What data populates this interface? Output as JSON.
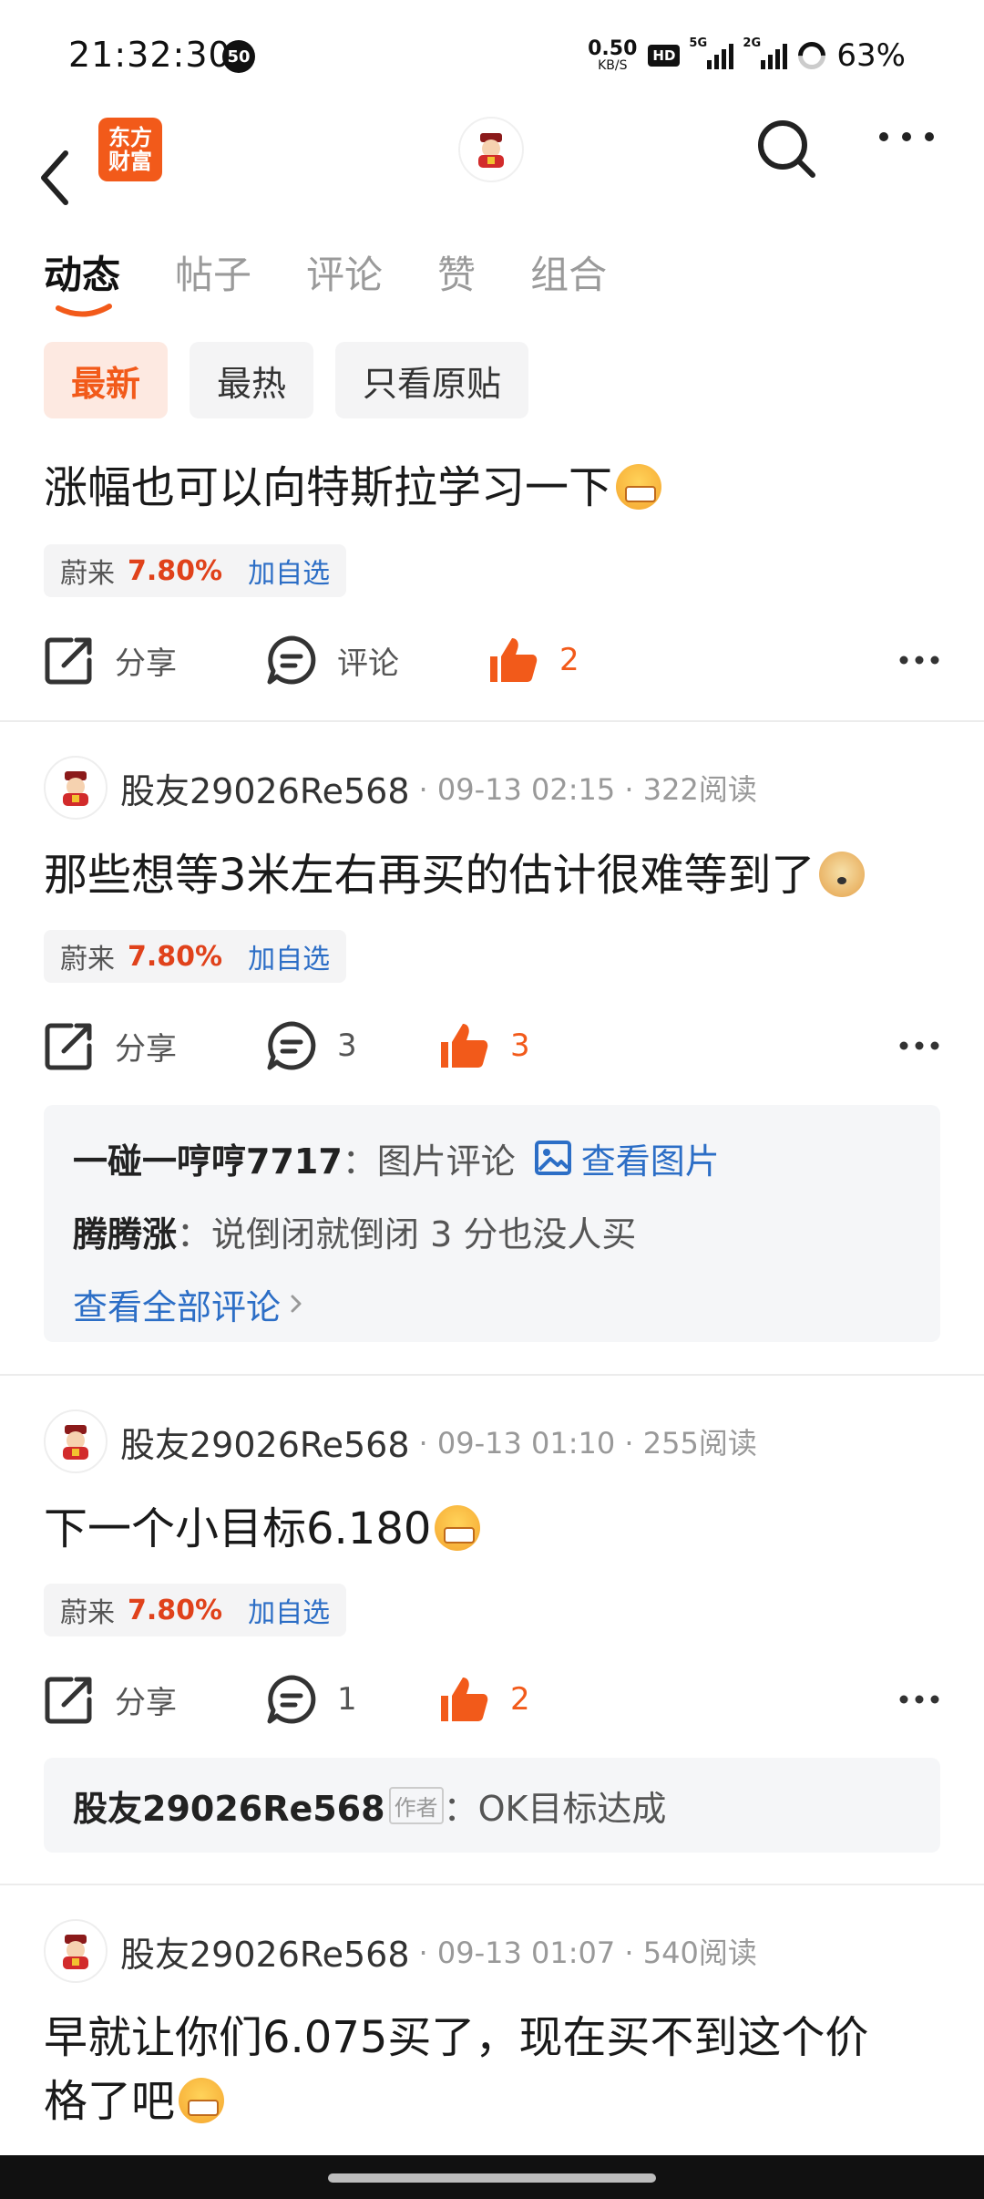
{
  "status_bar": {
    "time": "21:32:30",
    "notification_count": "50",
    "net_speed_value": "0.50",
    "net_speed_unit": "KB/S",
    "hd_label": "HD",
    "signal1_label": "5G",
    "signal2_label": "2G",
    "battery_percent": "63%"
  },
  "header": {
    "app_logo_line1": "东方",
    "app_logo_line2": "财富"
  },
  "tabs": [
    "动态",
    "帖子",
    "评论",
    "赞",
    "组合"
  ],
  "filters": [
    "最新",
    "最热",
    "只看原贴"
  ],
  "share_label": "分享",
  "comment_label": "评论",
  "posts": [
    {
      "text": "涨幅也可以向特斯拉学习一下",
      "stock_name": "蔚来",
      "stock_change": "7.80%",
      "add_watch": "加自选",
      "like_count": "2"
    },
    {
      "author": "股友29026Re568",
      "meta": "· 09-13 02:15 · 322阅读",
      "text": "那些想等3米左右再买的估计很难等到了",
      "stock_name": "蔚来",
      "stock_change": "7.80%",
      "add_watch": "加自选",
      "comment_count": "3",
      "like_count": "3",
      "comments": [
        {
          "user": "一碰一哼哼7717",
          "sep": "：",
          "text": "图片评论",
          "view_image": "查看图片"
        },
        {
          "user": "腾腾涨",
          "sep": "：",
          "text": "说倒闭就倒闭 3 分也没人买"
        }
      ],
      "view_all": "查看全部评论"
    },
    {
      "author": "股友29026Re568",
      "meta": "· 09-13 01:10 · 255阅读",
      "text": "下一个小目标6.180",
      "stock_name": "蔚来",
      "stock_change": "7.80%",
      "add_watch": "加自选",
      "comment_count": "1",
      "like_count": "2",
      "comments": [
        {
          "user": "股友29026Re568",
          "badge": "作者",
          "sep": "：",
          "text": "OK目标达成"
        }
      ]
    },
    {
      "author": "股友29026Re568",
      "meta": "· 09-13 01:07 · 540阅读",
      "text_line1": "早就让你们6.075买了，现在买不到这个价",
      "text_line2": "格了吧"
    }
  ]
}
